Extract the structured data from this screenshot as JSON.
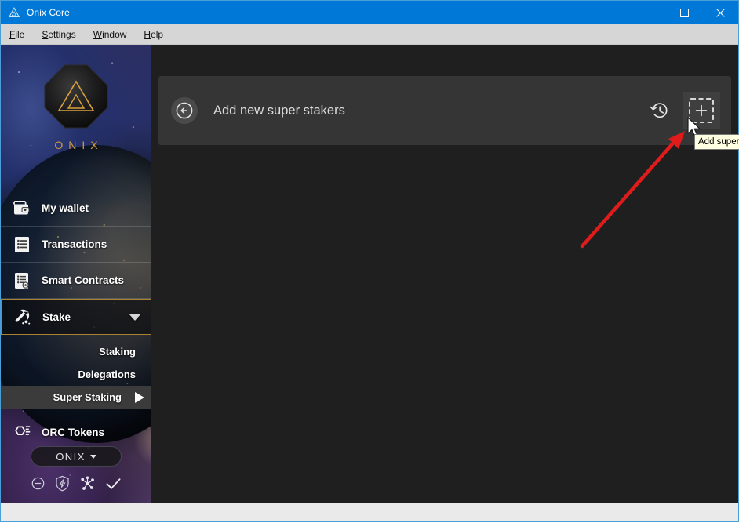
{
  "window": {
    "title": "Onix Core",
    "app_icon": "onix-triangle-icon",
    "minimize_label": "Minimize",
    "maximize_label": "Maximize",
    "close_label": "Close"
  },
  "menubar": {
    "items": [
      {
        "label": "File",
        "accel": "F",
        "rest": "ile"
      },
      {
        "label": "Settings",
        "accel": "S",
        "rest": "ettings"
      },
      {
        "label": "Window",
        "accel": "W",
        "rest": "indow"
      },
      {
        "label": "Help",
        "accel": "H",
        "rest": "elp"
      }
    ]
  },
  "sidebar": {
    "brand": "ONIX",
    "logo_icon": "onix-octagon-triangle-logo",
    "items": [
      {
        "label": "My wallet",
        "icon": "wallet-icon",
        "active": false
      },
      {
        "label": "Transactions",
        "icon": "transactions-list-icon",
        "active": false
      },
      {
        "label": "Smart Contracts",
        "icon": "contract-gear-icon",
        "active": false
      },
      {
        "label": "Stake",
        "icon": "pickaxe-mining-icon",
        "active": true
      }
    ],
    "submenu": [
      {
        "label": "Staking",
        "active": false
      },
      {
        "label": "Delegations",
        "active": false
      },
      {
        "label": "Super Staking",
        "active": true
      }
    ],
    "tokens_item": {
      "label": "ORC Tokens",
      "icon": "hexagon-token-icon"
    },
    "unit_selector": {
      "label": "ONIX",
      "icon": "chevron-down-icon"
    },
    "status_icons": [
      {
        "name": "sync-disabled-icon",
        "title": "minus-circle"
      },
      {
        "name": "staking-shield-icon",
        "title": "shield-bolt"
      },
      {
        "name": "network-connections-icon",
        "title": "nodes"
      },
      {
        "name": "synced-check-icon",
        "title": "check"
      }
    ]
  },
  "main": {
    "panel": {
      "back_icon": "back-arrow-circle-icon",
      "title": "Add new super stakers",
      "history_icon": "history-clock-icon",
      "add_icon": "plus-dashed-box-icon"
    }
  },
  "annotation": {
    "tooltip_text": "Add super",
    "cursor_icon": "mouse-pointer-icon",
    "arrow_icon": "red-arrow-annotation",
    "arrow_color": "#e01b1b"
  },
  "colors": {
    "titlebar": "#0078d7",
    "menubar": "#d6d6d6",
    "content_bg": "#1f1f1f",
    "panel_bg": "#353535",
    "accent_gold": "#a9832f",
    "brand_gold": "#cf9a3c",
    "tooltip_bg": "#ffffe1",
    "statusbar": "#eaeaea"
  }
}
